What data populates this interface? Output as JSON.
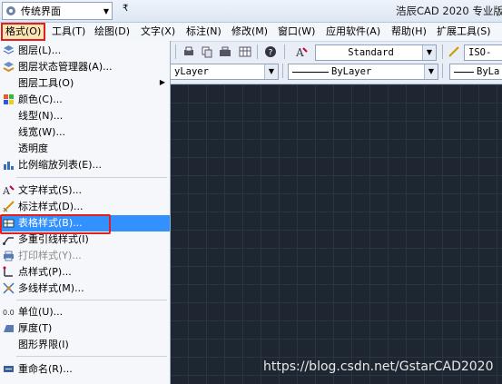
{
  "titlebar": {
    "workspace": "传统界面",
    "title": "浩辰CAD 2020 专业版"
  },
  "menubar": [
    {
      "label": "格式(O)",
      "active": true
    },
    {
      "label": "工具(T)"
    },
    {
      "label": "绘图(D)"
    },
    {
      "label": "文字(X)"
    },
    {
      "label": "标注(N)"
    },
    {
      "label": "修改(M)"
    },
    {
      "label": "窗口(W)"
    },
    {
      "label": "应用软件(A)"
    },
    {
      "label": "帮助(H)"
    },
    {
      "label": "扩展工具(S)"
    }
  ],
  "toolbar": {
    "text_style": "Standard",
    "dim_style": "ISO-",
    "layer_color": "yLayer",
    "linetype": "ByLayer",
    "lineweight": "ByLa"
  },
  "format_menu": [
    {
      "label": "图层(L)...",
      "icon": "layers-icon"
    },
    {
      "label": "图层状态管理器(A)...",
      "icon": "layer-state-icon"
    },
    {
      "label": "图层工具(O)",
      "icon": "",
      "submenu": true
    },
    {
      "label": "颜色(C)...",
      "icon": "color-icon"
    },
    {
      "label": "线型(N)...",
      "icon": ""
    },
    {
      "label": "线宽(W)...",
      "icon": ""
    },
    {
      "label": "透明度",
      "icon": ""
    },
    {
      "label": "比例缩放列表(E)...",
      "icon": "scale-list-icon"
    },
    {
      "label": "文字样式(S)...",
      "icon": "text-style-icon"
    },
    {
      "label": "标注样式(D)...",
      "icon": "dim-style-icon"
    },
    {
      "label": "表格样式(B)...",
      "icon": "table-style-icon",
      "highlight": true
    },
    {
      "label": "多重引线样式(I)",
      "icon": "mleader-icon"
    },
    {
      "label": "打印样式(Y)...",
      "icon": "print-style-icon",
      "disabled": true
    },
    {
      "label": "点样式(P)...",
      "icon": "point-style-icon"
    },
    {
      "label": "多线样式(M)...",
      "icon": "mline-icon"
    },
    {
      "label": "单位(U)...",
      "icon": "units-icon"
    },
    {
      "label": "厚度(T)",
      "icon": "thickness-icon"
    },
    {
      "label": "图形界限(I)",
      "icon": ""
    },
    {
      "label": "重命名(R)...",
      "icon": "rename-icon"
    }
  ],
  "watermark": "https://blog.csdn.net/GstarCAD2020"
}
